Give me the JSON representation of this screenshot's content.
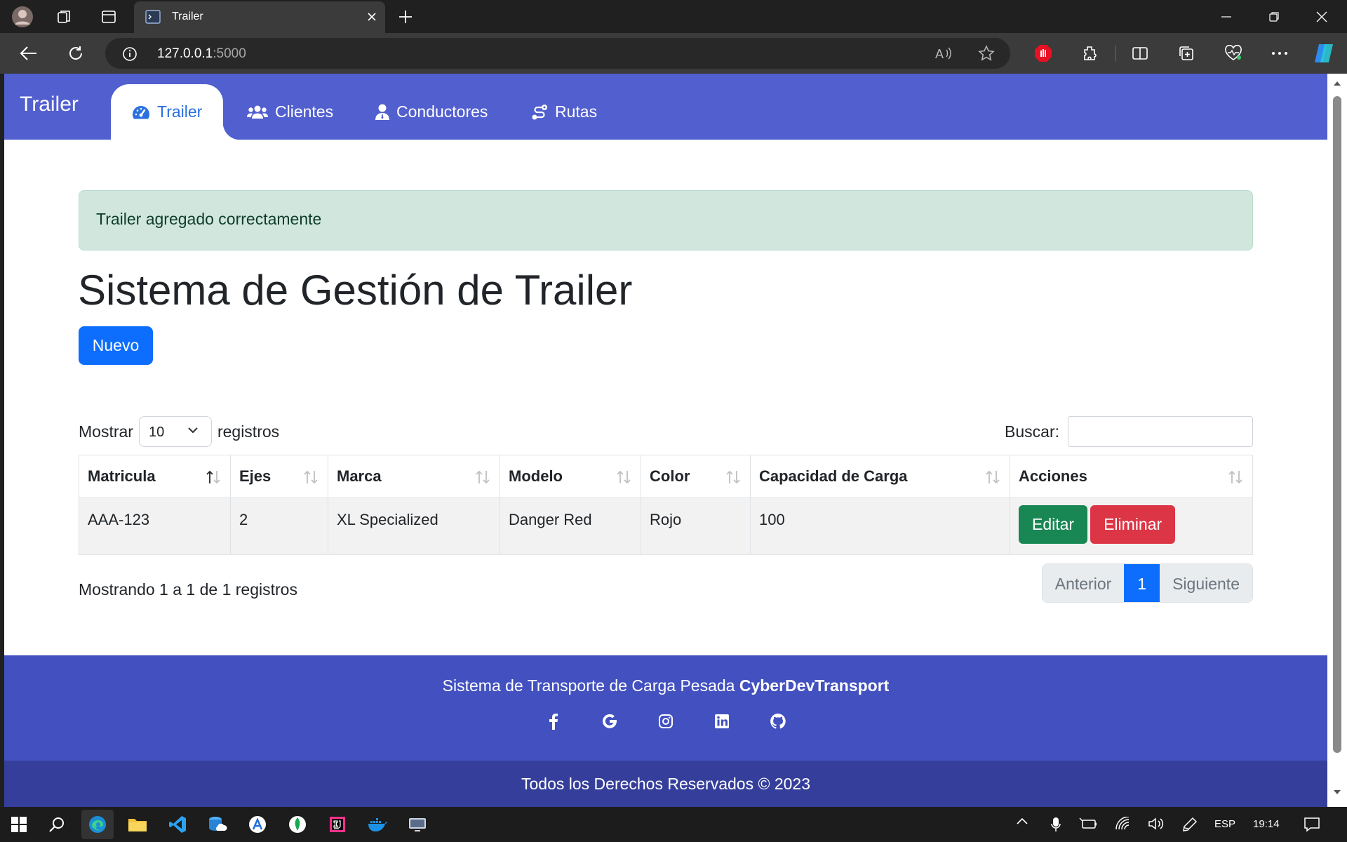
{
  "browser": {
    "tab_title": "Trailer",
    "url_host": "127.0.0.1",
    "url_port": ":5000"
  },
  "nav": {
    "brand": "Trailer",
    "items": [
      {
        "label": "Trailer",
        "icon": "gauge-icon",
        "active": true
      },
      {
        "label": "Clientes",
        "icon": "users-icon"
      },
      {
        "label": "Conductores",
        "icon": "user-tie-icon"
      },
      {
        "label": "Rutas",
        "icon": "route-icon"
      }
    ]
  },
  "alert": {
    "message": "Trailer agregado correctamente",
    "color": "#d1e7dd"
  },
  "page": {
    "title": "Sistema de Gestión de Trailer",
    "new_button": "Nuevo"
  },
  "datatable": {
    "show_label": "Mostrar",
    "show_value": "10",
    "records_label": "registros",
    "search_label": "Buscar:",
    "search_value": "",
    "columns": [
      "Matricula",
      "Ejes",
      "Marca",
      "Modelo",
      "Color",
      "Capacidad de Carga",
      "Acciones"
    ],
    "rows": [
      {
        "matricula": "AAA-123",
        "ejes": "2",
        "marca": "XL Specialized",
        "modelo": "Danger Red",
        "color": "Rojo",
        "capacidad": "100"
      }
    ],
    "edit_label": "Editar",
    "delete_label": "Eliminar",
    "info": "Mostrando 1 a 1 de 1 registros",
    "prev_label": "Anterior",
    "current_page": "1",
    "next_label": "Siguiente"
  },
  "footer": {
    "text": "Sistema de Transporte de Carga Pesada ",
    "brand": "CyberDevTransport",
    "social": [
      "facebook-icon",
      "google-icon",
      "instagram-icon",
      "linkedin-icon",
      "github-icon"
    ],
    "copyright": "Todos los Derechos Reservados © 2023"
  },
  "taskbar": {
    "language": "ESP",
    "time": "19:14"
  },
  "colors": {
    "navbar": "#525fcf",
    "footer": "#4351c0",
    "copyright_bar": "#353f9b",
    "primary": "#0d6efd",
    "success": "#198754",
    "danger": "#dc3545"
  }
}
